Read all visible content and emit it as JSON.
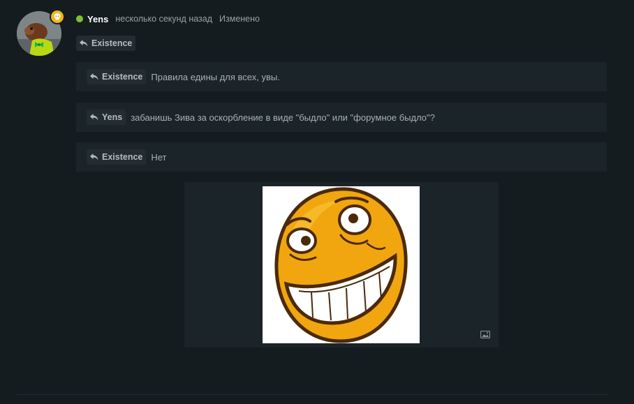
{
  "post": {
    "author": "Yens",
    "timestamp": "несколько секунд назад",
    "edited_label": "Изменено",
    "status": "online",
    "reply_to": "Existence",
    "quotes": [
      {
        "author": "Existence",
        "text": "Правила едины для всех, увы."
      },
      {
        "author": "Yens",
        "text": "забанишь Зива за оскорбление в виде \"быдло\" или \"форумное быдло\"?"
      },
      {
        "author": "Existence",
        "text": "Нет"
      }
    ],
    "image": {
      "icon": "image-icon"
    }
  },
  "icons": {
    "avatar_badge": "skull-icon",
    "reply": "reply-arrow-icon"
  },
  "colors": {
    "background": "#151c20",
    "quote_background": "#1b2428",
    "online": "#7ac231",
    "badge": "#f2b61d"
  }
}
